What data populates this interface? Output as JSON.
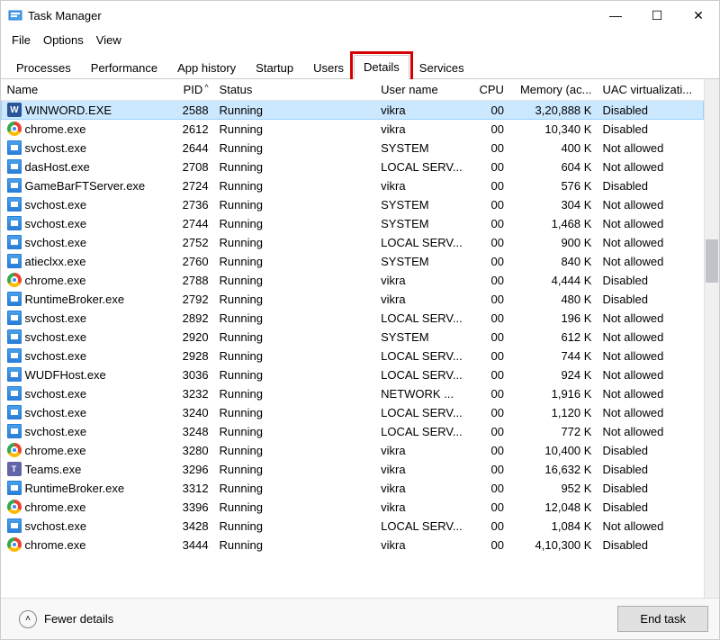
{
  "window": {
    "title": "Task Manager",
    "minimize": "—",
    "maximize": "☐",
    "close": "✕"
  },
  "menu": {
    "file": "File",
    "options": "Options",
    "view": "View"
  },
  "tabs": {
    "processes": "Processes",
    "performance": "Performance",
    "app_history": "App history",
    "startup": "Startup",
    "users": "Users",
    "details": "Details",
    "services": "Services"
  },
  "columns": {
    "name": "Name",
    "pid": "PID",
    "status": "Status",
    "user": "User name",
    "cpu": "CPU",
    "memory": "Memory (ac...",
    "uac": "UAC virtualizati..."
  },
  "rows": [
    {
      "icon": "word",
      "name": "WINWORD.EXE",
      "pid": "2588",
      "status": "Running",
      "user": "vikra",
      "cpu": "00",
      "mem": "3,20,888 K",
      "uac": "Disabled"
    },
    {
      "icon": "chrome",
      "name": "chrome.exe",
      "pid": "2612",
      "status": "Running",
      "user": "vikra",
      "cpu": "00",
      "mem": "10,340 K",
      "uac": "Disabled"
    },
    {
      "icon": "generic",
      "name": "svchost.exe",
      "pid": "2644",
      "status": "Running",
      "user": "SYSTEM",
      "cpu": "00",
      "mem": "400 K",
      "uac": "Not allowed"
    },
    {
      "icon": "generic",
      "name": "dasHost.exe",
      "pid": "2708",
      "status": "Running",
      "user": "LOCAL SERV...",
      "cpu": "00",
      "mem": "604 K",
      "uac": "Not allowed"
    },
    {
      "icon": "generic",
      "name": "GameBarFTServer.exe",
      "pid": "2724",
      "status": "Running",
      "user": "vikra",
      "cpu": "00",
      "mem": "576 K",
      "uac": "Disabled"
    },
    {
      "icon": "generic",
      "name": "svchost.exe",
      "pid": "2736",
      "status": "Running",
      "user": "SYSTEM",
      "cpu": "00",
      "mem": "304 K",
      "uac": "Not allowed"
    },
    {
      "icon": "generic",
      "name": "svchost.exe",
      "pid": "2744",
      "status": "Running",
      "user": "SYSTEM",
      "cpu": "00",
      "mem": "1,468 K",
      "uac": "Not allowed"
    },
    {
      "icon": "generic",
      "name": "svchost.exe",
      "pid": "2752",
      "status": "Running",
      "user": "LOCAL SERV...",
      "cpu": "00",
      "mem": "900 K",
      "uac": "Not allowed"
    },
    {
      "icon": "generic",
      "name": "atieclxx.exe",
      "pid": "2760",
      "status": "Running",
      "user": "SYSTEM",
      "cpu": "00",
      "mem": "840 K",
      "uac": "Not allowed"
    },
    {
      "icon": "chrome",
      "name": "chrome.exe",
      "pid": "2788",
      "status": "Running",
      "user": "vikra",
      "cpu": "00",
      "mem": "4,444 K",
      "uac": "Disabled"
    },
    {
      "icon": "generic",
      "name": "RuntimeBroker.exe",
      "pid": "2792",
      "status": "Running",
      "user": "vikra",
      "cpu": "00",
      "mem": "480 K",
      "uac": "Disabled"
    },
    {
      "icon": "generic",
      "name": "svchost.exe",
      "pid": "2892",
      "status": "Running",
      "user": "LOCAL SERV...",
      "cpu": "00",
      "mem": "196 K",
      "uac": "Not allowed"
    },
    {
      "icon": "generic",
      "name": "svchost.exe",
      "pid": "2920",
      "status": "Running",
      "user": "SYSTEM",
      "cpu": "00",
      "mem": "612 K",
      "uac": "Not allowed"
    },
    {
      "icon": "generic",
      "name": "svchost.exe",
      "pid": "2928",
      "status": "Running",
      "user": "LOCAL SERV...",
      "cpu": "00",
      "mem": "744 K",
      "uac": "Not allowed"
    },
    {
      "icon": "generic",
      "name": "WUDFHost.exe",
      "pid": "3036",
      "status": "Running",
      "user": "LOCAL SERV...",
      "cpu": "00",
      "mem": "924 K",
      "uac": "Not allowed"
    },
    {
      "icon": "generic",
      "name": "svchost.exe",
      "pid": "3232",
      "status": "Running",
      "user": "NETWORK ...",
      "cpu": "00",
      "mem": "1,916 K",
      "uac": "Not allowed"
    },
    {
      "icon": "generic",
      "name": "svchost.exe",
      "pid": "3240",
      "status": "Running",
      "user": "LOCAL SERV...",
      "cpu": "00",
      "mem": "1,120 K",
      "uac": "Not allowed"
    },
    {
      "icon": "generic",
      "name": "svchost.exe",
      "pid": "3248",
      "status": "Running",
      "user": "LOCAL SERV...",
      "cpu": "00",
      "mem": "772 K",
      "uac": "Not allowed"
    },
    {
      "icon": "chrome",
      "name": "chrome.exe",
      "pid": "3280",
      "status": "Running",
      "user": "vikra",
      "cpu": "00",
      "mem": "10,400 K",
      "uac": "Disabled"
    },
    {
      "icon": "teams",
      "name": "Teams.exe",
      "pid": "3296",
      "status": "Running",
      "user": "vikra",
      "cpu": "00",
      "mem": "16,632 K",
      "uac": "Disabled"
    },
    {
      "icon": "generic",
      "name": "RuntimeBroker.exe",
      "pid": "3312",
      "status": "Running",
      "user": "vikra",
      "cpu": "00",
      "mem": "952 K",
      "uac": "Disabled"
    },
    {
      "icon": "chrome",
      "name": "chrome.exe",
      "pid": "3396",
      "status": "Running",
      "user": "vikra",
      "cpu": "00",
      "mem": "12,048 K",
      "uac": "Disabled"
    },
    {
      "icon": "generic",
      "name": "svchost.exe",
      "pid": "3428",
      "status": "Running",
      "user": "LOCAL SERV...",
      "cpu": "00",
      "mem": "1,084 K",
      "uac": "Not allowed"
    },
    {
      "icon": "chrome",
      "name": "chrome.exe",
      "pid": "3444",
      "status": "Running",
      "user": "vikra",
      "cpu": "00",
      "mem": "4,10,300 K",
      "uac": "Disabled"
    }
  ],
  "footer": {
    "fewer": "Fewer details",
    "end_task": "End task"
  }
}
